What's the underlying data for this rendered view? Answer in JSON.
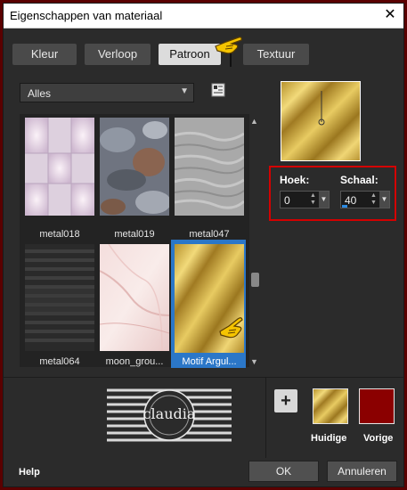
{
  "window": {
    "title": "Eigenschappen van materiaal",
    "close_glyph": "✕"
  },
  "tabs": [
    {
      "label": "Kleur"
    },
    {
      "label": "Verloop"
    },
    {
      "label": "Patroon"
    },
    {
      "label": "Textuur"
    }
  ],
  "active_tab": "Patroon",
  "category": {
    "selected": "Alles",
    "options_visible": [
      "Alles"
    ]
  },
  "patterns": [
    {
      "name": "metal018",
      "selected": false
    },
    {
      "name": "metal019",
      "selected": false
    },
    {
      "name": "metal047",
      "selected": false
    },
    {
      "name": "metal064",
      "selected": false
    },
    {
      "name": "moon_grou...",
      "selected": false
    },
    {
      "name": "Motif Argul...",
      "selected": true
    }
  ],
  "angle": {
    "label": "Hoek:",
    "value": "0"
  },
  "scale": {
    "label": "Schaal:",
    "value": "40"
  },
  "swatches": {
    "add_glyph": "+",
    "current_label": "Huidige",
    "previous_label": "Vorige",
    "previous_color": "#8b0000"
  },
  "logo_text": "claudia",
  "footer": {
    "help": "Help",
    "ok": "OK",
    "cancel": "Annuleren"
  },
  "colors": {
    "accent": "#2b77c8",
    "highlight_border": "#d40000",
    "gold": "#c9a640"
  }
}
